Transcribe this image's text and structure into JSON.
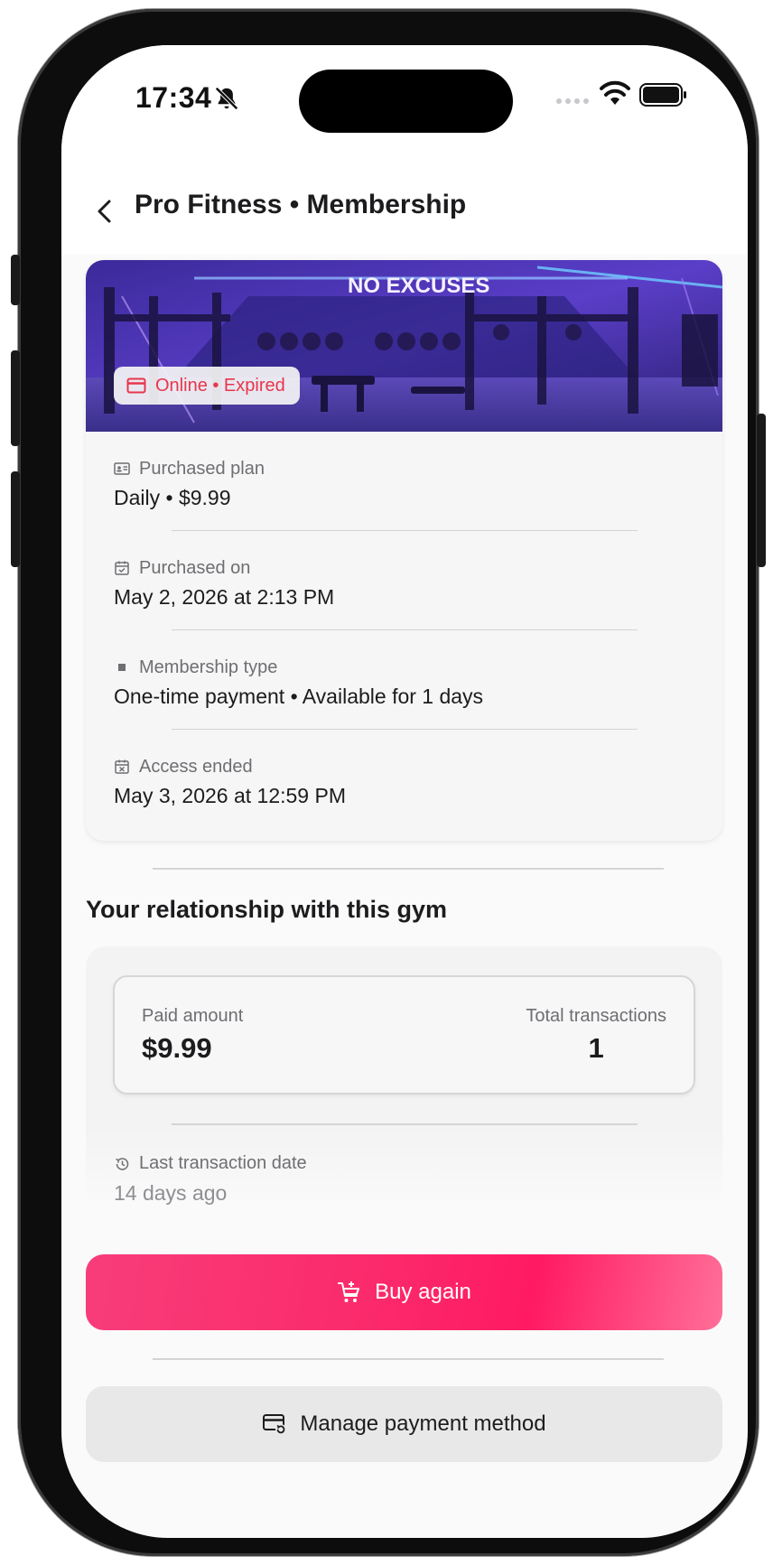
{
  "status_bar": {
    "time": "17:34"
  },
  "header": {
    "title": "Pro Fitness • Membership"
  },
  "membership_card": {
    "hero_sign": "NO EXCUSES",
    "status_badge": "Online • Expired",
    "details": [
      {
        "icon": "id-card-icon",
        "label": "Purchased plan",
        "value": "Daily • $9.99"
      },
      {
        "icon": "calendar-check-icon",
        "label": "Purchased on",
        "value": "May 2, 2026 at 2:13 PM"
      },
      {
        "icon": "square-icon",
        "label": "Membership type",
        "value": "One-time payment • Available for 1 days"
      },
      {
        "icon": "calendar-x-icon",
        "label": "Access ended",
        "value": "May 3, 2026 at 12:59 PM"
      }
    ]
  },
  "relationship": {
    "title": "Your relationship with this gym",
    "paid_amount_label": "Paid amount",
    "paid_amount_value": "$9.99",
    "total_transactions_label": "Total transactions",
    "total_transactions_value": "1",
    "last_transaction_label": "Last transaction date",
    "last_transaction_value": "14 days ago"
  },
  "actions": {
    "buy_again": "Buy again",
    "manage_payment": "Manage payment method"
  },
  "colors": {
    "accent": "#fb2a6c",
    "expired": "#e8364c",
    "background": "#fafafa"
  }
}
